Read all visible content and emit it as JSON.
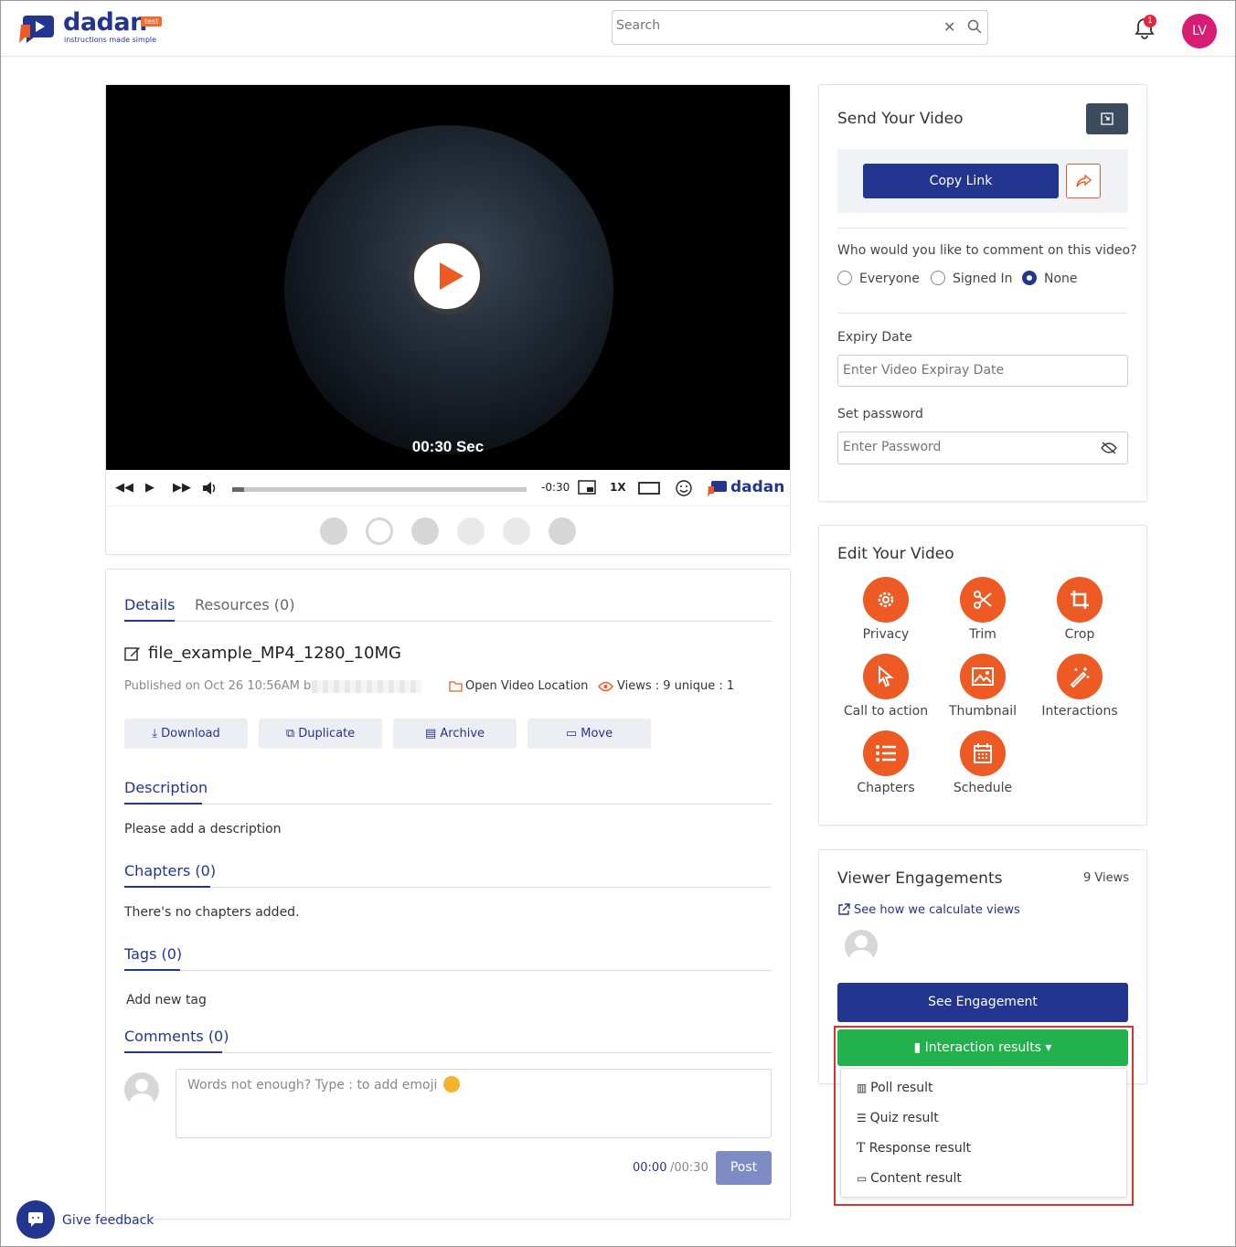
{
  "header": {
    "logo_text": "dadan",
    "logo_tag": "test",
    "logo_sub": "instructions made simple",
    "search_placeholder": "Search",
    "notification_count": "1",
    "avatar_initials": "LV"
  },
  "player": {
    "overlay_time": "00:30 Sec",
    "remaining": "-0:30",
    "speed": "1X",
    "brand": "dadan",
    "progress_fraction": 0.04
  },
  "details": {
    "tabs": [
      "Details",
      "Resources (0)"
    ],
    "file_name": "file_example_MP4_1280_10MG",
    "published": "Published on Oct 26 10:56AM by",
    "open_location": "Open Video Location",
    "views": "Views : 9 unique : 1",
    "actions": [
      "Download",
      "Duplicate",
      "Archive",
      "Move"
    ],
    "description_title": "Description",
    "description_text": "Please add a description",
    "chapters_title": "Chapters (0)",
    "chapters_text": "There's no chapters added.",
    "tags_title": "Tags (0)",
    "tags_text": "Add new tag",
    "comments_title": "Comments (0)",
    "comment_placeholder": "Words not enough? Type : to add emoji",
    "comment_time": "00:00",
    "comment_duration": "/00:30",
    "post_label": "Post"
  },
  "send": {
    "title": "Send Your Video",
    "copy_link": "Copy Link",
    "comment_question": "Who would you like to comment on this video?",
    "options": [
      "Everyone",
      "Signed In",
      "None"
    ],
    "selected": "None",
    "expiry_label": "Expiry Date",
    "expiry_placeholder": "Enter Video Expiray Date",
    "password_label": "Set password",
    "password_placeholder": "Enter Password"
  },
  "edit": {
    "title": "Edit Your Video",
    "items": [
      "Privacy",
      "Trim",
      "Crop",
      "Call to action",
      "Thumbnail",
      "Interactions",
      "Chapters",
      "Schedule"
    ]
  },
  "engagement": {
    "title": "Viewer Engagements",
    "views": "9 Views",
    "how_link": "See how we calculate views",
    "see_engagement": "See Engagement",
    "interaction_results": "Interaction results",
    "menu": [
      "Poll result",
      "Quiz result",
      "Response result",
      "Content result"
    ]
  },
  "feedback": "Give feedback",
  "colors": {
    "primary": "#22358f",
    "accent": "#ee5a24",
    "success": "#22b14c",
    "highlight": "#d9342b"
  }
}
